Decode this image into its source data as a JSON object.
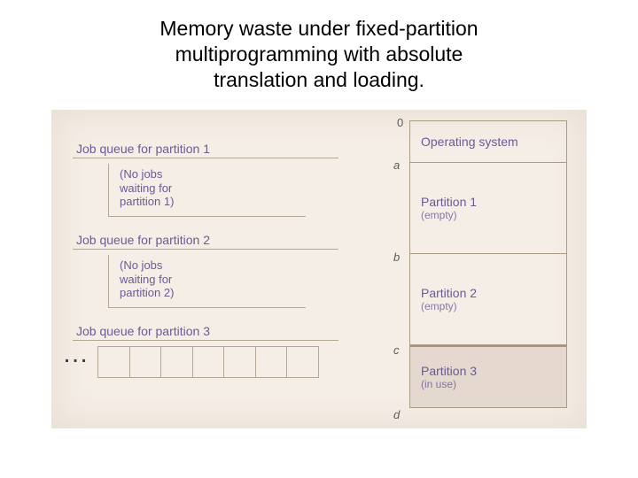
{
  "title_line1": "Memory waste under fixed-partition",
  "title_line2": "multiprogramming with absolute",
  "title_line3": "translation and loading.",
  "queues": {
    "q1_label": "Job queue for partition 1",
    "q1_empty": "(No jobs\nwaiting for\npartition 1)",
    "q2_label": "Job queue for partition 2",
    "q2_empty": "(No jobs\nwaiting for\npartition 2)",
    "q3_label": "Job queue for partition 3",
    "ellipsis": "…"
  },
  "addresses": {
    "a0": "0",
    "a": "a",
    "b": "b",
    "c": "c",
    "d": "d"
  },
  "memory": {
    "os": "Operating system",
    "p1": "Partition 1",
    "p1_state": "(empty)",
    "p2": "Partition 2",
    "p2_state": "(empty)",
    "p3": "Partition 3",
    "p3_state": "(in use)"
  }
}
